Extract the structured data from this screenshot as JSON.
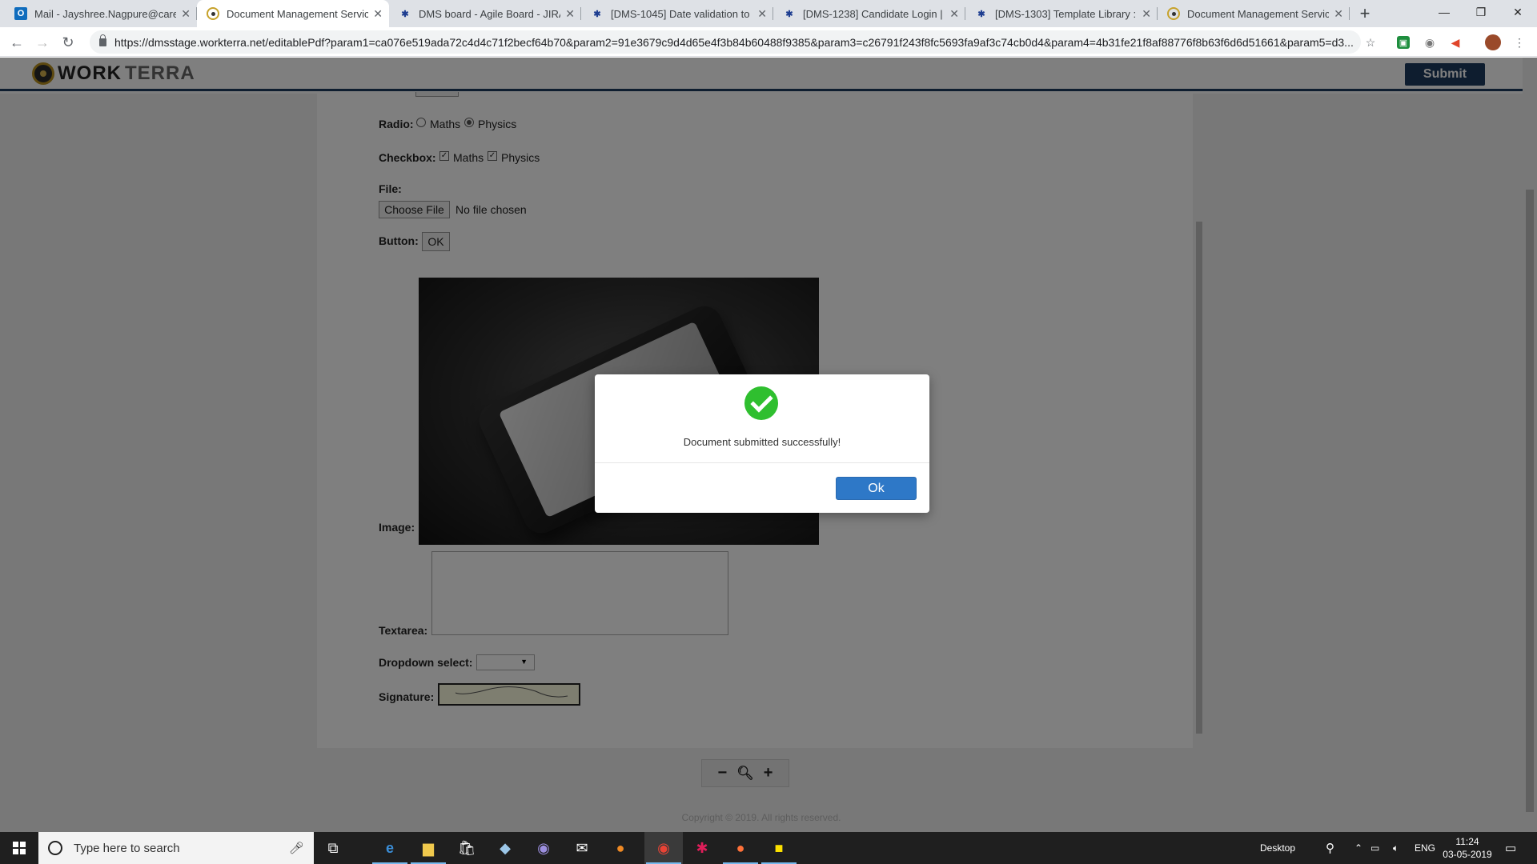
{
  "browser": {
    "tabs": [
      {
        "title": "Mail - Jayshree.Nagpure@career",
        "icon": "outlook-icon",
        "active": false
      },
      {
        "title": "Document Management Service",
        "icon": "workterra-icon",
        "active": true
      },
      {
        "title": "DMS board - Agile Board - JIRA",
        "icon": "jira-icon",
        "active": false
      },
      {
        "title": "[DMS-1045] Date validation to b",
        "icon": "jira-icon",
        "active": false
      },
      {
        "title": "[DMS-1238] Candidate Login | Sc",
        "icon": "jira-icon",
        "active": false
      },
      {
        "title": "[DMS-1303] Template Library : Sc",
        "icon": "jira-icon",
        "active": false
      },
      {
        "title": "Document Management Service",
        "icon": "workterra-icon",
        "active": false
      }
    ],
    "url": "https://dmsstage.workterra.net/editablePdf?param1=ca076e519ada72c4d4c71f2becf64b70&param2=91e3679c9d4d65e4f3b84b60488f9385&param3=c26791f243f8fc5693fa9af3c74cb0d4&param4=4b31fe21f8af88776f8b63f6d6d51661&param5=d3..."
  },
  "app": {
    "logo_part1": "WORK",
    "logo_part2": "TERRA",
    "submit_label": "Submit"
  },
  "form": {
    "radio_label": "Radio:",
    "radio_options": [
      "Maths",
      "Physics"
    ],
    "radio_selected": "Physics",
    "checkbox_label": "Checkbox:",
    "checkbox_options": [
      "Maths",
      "Physics"
    ],
    "file_label": "File:",
    "file_button": "Choose File",
    "file_status": "No file chosen",
    "button_label": "Button:",
    "button_text": "OK",
    "image_label": "Image:",
    "textarea_label": "Textarea:",
    "dropdown_label": "Dropdown select:",
    "signature_label": "Signature:"
  },
  "zoom": {
    "minus": "−",
    "plus": "+"
  },
  "footer": {
    "copyright": "Copyright © 2019. All rights reserved."
  },
  "dialog": {
    "message": "Document submitted successfully!",
    "ok_label": "Ok",
    "colors": {
      "success": "#2fbf2f",
      "ok_button": "#2e78c7"
    }
  },
  "taskbar": {
    "search_placeholder": "Type here to search",
    "desktop_label": "Desktop",
    "language": "ENG",
    "time": "11:24",
    "date": "03-05-2019"
  },
  "colors": {
    "brand": "#1c3a5e"
  }
}
